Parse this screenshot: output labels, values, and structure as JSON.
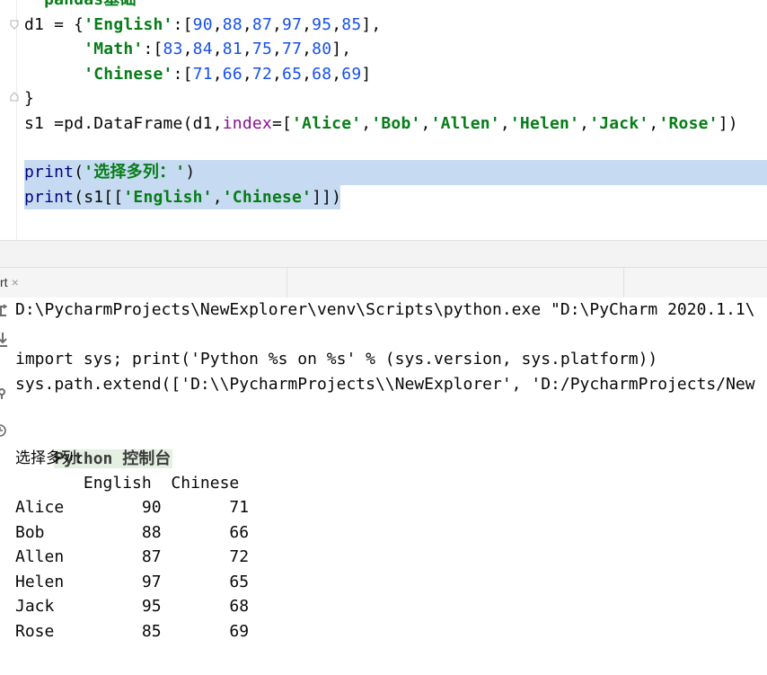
{
  "editor": {
    "lines": [
      {
        "tokens": [
          {
            "t": "pandas基础",
            "c": "str"
          }
        ],
        "indent": "  "
      },
      {
        "tokens": [
          {
            "t": "d1 = {"
          },
          {
            "t": "'English'",
            "c": "str"
          },
          {
            "t": ":["
          },
          {
            "t": "90",
            "c": "num"
          },
          {
            "t": ","
          },
          {
            "t": "88",
            "c": "num"
          },
          {
            "t": ","
          },
          {
            "t": "87",
            "c": "num"
          },
          {
            "t": ","
          },
          {
            "t": "97",
            "c": "num"
          },
          {
            "t": ","
          },
          {
            "t": "95",
            "c": "num"
          },
          {
            "t": ","
          },
          {
            "t": "85",
            "c": "num"
          },
          {
            "t": "],"
          }
        ]
      },
      {
        "tokens": [
          {
            "t": "      "
          },
          {
            "t": "'Math'",
            "c": "str"
          },
          {
            "t": ":["
          },
          {
            "t": "83",
            "c": "num"
          },
          {
            "t": ","
          },
          {
            "t": "84",
            "c": "num"
          },
          {
            "t": ","
          },
          {
            "t": "81",
            "c": "num"
          },
          {
            "t": ","
          },
          {
            "t": "75",
            "c": "num"
          },
          {
            "t": ","
          },
          {
            "t": "77",
            "c": "num"
          },
          {
            "t": ","
          },
          {
            "t": "80",
            "c": "num"
          },
          {
            "t": "],"
          }
        ]
      },
      {
        "tokens": [
          {
            "t": "      "
          },
          {
            "t": "'Chinese'",
            "c": "str"
          },
          {
            "t": ":["
          },
          {
            "t": "71",
            "c": "num"
          },
          {
            "t": ","
          },
          {
            "t": "66",
            "c": "num"
          },
          {
            "t": ","
          },
          {
            "t": "72",
            "c": "num"
          },
          {
            "t": ","
          },
          {
            "t": "65",
            "c": "num"
          },
          {
            "t": ","
          },
          {
            "t": "68",
            "c": "num"
          },
          {
            "t": ","
          },
          {
            "t": "69",
            "c": "num"
          },
          {
            "t": "]"
          }
        ]
      },
      {
        "tokens": [
          {
            "t": "}"
          }
        ]
      },
      {
        "tokens": [
          {
            "t": "s1 =pd.DataFrame(d1,"
          },
          {
            "t": "index",
            "c": "kw"
          },
          {
            "t": "=["
          },
          {
            "t": "'Alice'",
            "c": "str"
          },
          {
            "t": ","
          },
          {
            "t": "'Bob'",
            "c": "str"
          },
          {
            "t": ","
          },
          {
            "t": "'Allen'",
            "c": "str"
          },
          {
            "t": ","
          },
          {
            "t": "'Helen'",
            "c": "str"
          },
          {
            "t": ","
          },
          {
            "t": "'Jack'",
            "c": "str"
          },
          {
            "t": ","
          },
          {
            "t": "'Rose'",
            "c": "str"
          },
          {
            "t": "])"
          }
        ]
      },
      {
        "tokens": []
      },
      {
        "tokens": [
          {
            "t": "print",
            "c": "fn"
          },
          {
            "t": "("
          },
          {
            "t": "'选择多列：'",
            "c": "str"
          },
          {
            "t": ")"
          }
        ]
      },
      {
        "tokens": [
          {
            "t": "print",
            "c": "fn"
          },
          {
            "t": "(s1[["
          },
          {
            "t": "'English'",
            "c": "str"
          },
          {
            "t": ","
          },
          {
            "t": "'Chinese'",
            "c": "str"
          },
          {
            "t": "]])"
          }
        ]
      }
    ]
  },
  "tabbar": {
    "tab_label": "rt",
    "close_symbol": "×"
  },
  "console": {
    "cmd_line": "D:\\PycharmProjects\\NewExplorer\\venv\\Scripts\\python.exe \"D:\\PyCharm 2020.1.1\\",
    "import_line": "import sys; print('Python %s on %s' % (sys.version, sys.platform))",
    "path_line": "sys.path.extend(['D:\\\\PycharmProjects\\\\NewExplorer', 'D:/PycharmProjects/New",
    "prompt_label": "Python 控制台",
    "print_label": "选择多列:",
    "table": {
      "header": "       English  Chinese",
      "rows": [
        {
          "name": "Alice",
          "english": "90",
          "chinese": "71"
        },
        {
          "name": "Bob",
          "english": "88",
          "chinese": "66"
        },
        {
          "name": "Allen",
          "english": "87",
          "chinese": "72"
        },
        {
          "name": "Helen",
          "english": "97",
          "chinese": "65"
        },
        {
          "name": "Jack",
          "english": "95",
          "chinese": "68"
        },
        {
          "name": "Rose",
          "english": "85",
          "chinese": "69"
        }
      ]
    }
  },
  "tools": [
    "rerun-icon",
    "stop-icon",
    "settings-icon",
    "history-icon"
  ]
}
